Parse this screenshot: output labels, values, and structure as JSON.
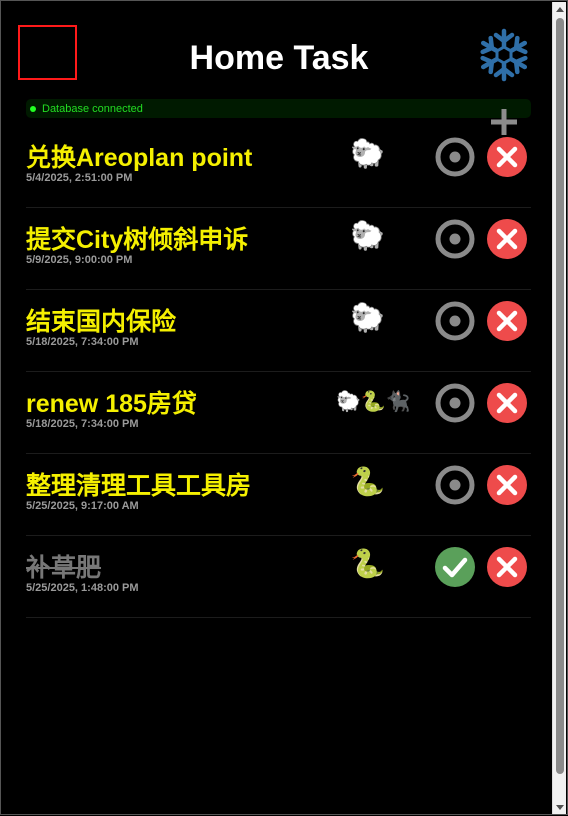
{
  "app": {
    "title": "Home Task"
  },
  "status": {
    "text": "Database connected",
    "color": "#22dd22"
  },
  "icons": {
    "header_right": "snowflake-icon",
    "add": "plus-icon",
    "pending": "target-icon",
    "done": "check-icon",
    "delete": "close-icon"
  },
  "colors": {
    "background": "#000000",
    "task_title": "#f5f000",
    "done_title": "#777777",
    "delete": "#ee4b4b",
    "done_check": "#5aa05a",
    "pending_ring": "#8a8a8a"
  },
  "tasks": [
    {
      "title": "兑换Areoplan point",
      "date": "5/4/2025, 2:51:00 PM",
      "assignees": "🐑",
      "done": false
    },
    {
      "title": "提交City树倾斜申诉",
      "date": "5/9/2025, 9:00:00 PM",
      "assignees": "🐑",
      "done": false
    },
    {
      "title": "结束国内保险",
      "date": "5/18/2025, 7:34:00 PM",
      "assignees": "🐑",
      "done": false
    },
    {
      "title": "renew 185房贷",
      "date": "5/18/2025, 7:34:00 PM",
      "assignees": "🐑🐍🐈‍⬛",
      "done": false
    },
    {
      "title": "整理清理工具工具房",
      "date": "5/25/2025, 9:17:00 AM",
      "assignees": "🐍",
      "done": false
    },
    {
      "title": "补草肥",
      "date": "5/25/2025, 1:48:00 PM",
      "assignees": "🐍",
      "done": true
    }
  ]
}
